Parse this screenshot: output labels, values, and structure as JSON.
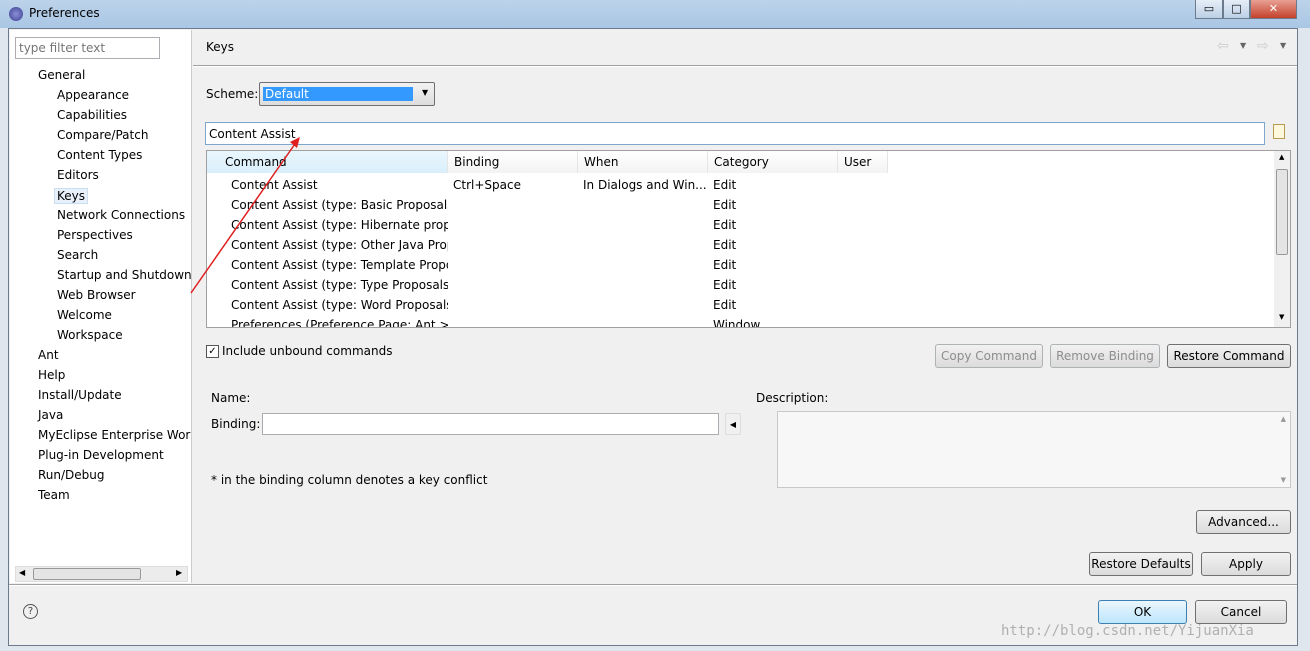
{
  "window": {
    "title": "Preferences",
    "minimize": "▭",
    "maximize": "□",
    "close": "✕"
  },
  "filter": {
    "placeholder": "type filter text"
  },
  "tree": [
    {
      "label": "General",
      "level": 0
    },
    {
      "label": "Appearance",
      "level": 1
    },
    {
      "label": "Capabilities",
      "level": 1
    },
    {
      "label": "Compare/Patch",
      "level": 1
    },
    {
      "label": "Content Types",
      "level": 1
    },
    {
      "label": "Editors",
      "level": 1
    },
    {
      "label": "Keys",
      "level": 1,
      "selected": true
    },
    {
      "label": "Network Connections",
      "level": 1
    },
    {
      "label": "Perspectives",
      "level": 1
    },
    {
      "label": "Search",
      "level": 1
    },
    {
      "label": "Startup and Shutdown",
      "level": 1
    },
    {
      "label": "Web Browser",
      "level": 1
    },
    {
      "label": "Welcome",
      "level": 1
    },
    {
      "label": "Workspace",
      "level": 1
    },
    {
      "label": "Ant",
      "level": 0
    },
    {
      "label": "Help",
      "level": 0
    },
    {
      "label": "Install/Update",
      "level": 0
    },
    {
      "label": "Java",
      "level": 0
    },
    {
      "label": "MyEclipse Enterprise Wor",
      "level": 0
    },
    {
      "label": "Plug-in Development",
      "level": 0
    },
    {
      "label": "Run/Debug",
      "level": 0
    },
    {
      "label": "Team",
      "level": 0
    }
  ],
  "page": {
    "title": "Keys"
  },
  "scheme": {
    "label": "Scheme:",
    "value": "Default"
  },
  "search": {
    "value": "Content Assist"
  },
  "table": {
    "columns": [
      "Command",
      "Binding",
      "When",
      "Category",
      "User"
    ],
    "rows": [
      [
        "Content Assist",
        "Ctrl+Space",
        "In Dialogs and Win...",
        "Edit",
        ""
      ],
      [
        "Content Assist (type: Basic Proposals)",
        "",
        "",
        "Edit",
        ""
      ],
      [
        "Content Assist (type: Hibernate propo",
        "",
        "",
        "Edit",
        ""
      ],
      [
        "Content Assist (type: Other Java Prop",
        "",
        "",
        "Edit",
        ""
      ],
      [
        "Content Assist (type: Template Propo",
        "",
        "",
        "Edit",
        ""
      ],
      [
        "Content Assist (type: Type Proposals)",
        "",
        "",
        "Edit",
        ""
      ],
      [
        "Content Assist (type: Word Proposals",
        "",
        "",
        "Edit",
        ""
      ],
      [
        "Preferences (Preference Page: Ant > I",
        "",
        "",
        "Window",
        ""
      ]
    ]
  },
  "include_unbound": {
    "label": "Include unbound commands",
    "checked": true
  },
  "buttons": {
    "copy": "Copy Command",
    "remove": "Remove Binding",
    "restore": "Restore Command",
    "advanced": "Advanced...",
    "restore_defaults": "Restore Defaults",
    "apply": "Apply",
    "ok": "OK",
    "cancel": "Cancel"
  },
  "details": {
    "name_label": "Name:",
    "binding_label": "Binding:",
    "description_label": "Description:",
    "conflict_note": "* in the binding column denotes a key conflict"
  },
  "watermark": "http://blog.csdn.net/YijuanXia"
}
